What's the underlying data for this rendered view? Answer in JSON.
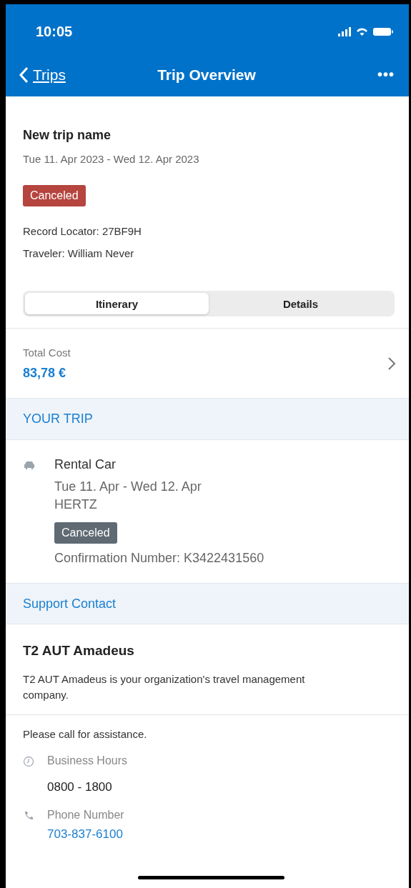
{
  "status_bar": {
    "time": "10:05"
  },
  "nav": {
    "back": "Trips",
    "title": "Trip Overview",
    "more": "•••"
  },
  "trip": {
    "name": "New trip name",
    "dates": "Tue 11. Apr 2023 - Wed 12. Apr 2023",
    "status": "Canceled",
    "record_locator": "Record Locator: 27BF9H",
    "traveler": "Traveler: William Never"
  },
  "tabs": [
    {
      "label": "Itinerary",
      "selected": true
    },
    {
      "label": "Details",
      "selected": false
    }
  ],
  "total": {
    "label": "Total Cost",
    "value": "83,78 €"
  },
  "your_trip": {
    "heading": "YOUR TRIP",
    "segments": [
      {
        "kind": "car",
        "title": "Rental Car",
        "dates": "Tue 11. Apr - Wed 12. Apr",
        "vendor": "HERTZ",
        "status": "Canceled",
        "confirmation": "Confirmation Number: K3422431560"
      }
    ]
  },
  "support": {
    "heading": "Support Contact",
    "company": "T2 AUT Amadeus",
    "description": "T2 AUT Amadeus is your organization's travel management company.",
    "prompt": "Please call for assistance.",
    "items": [
      {
        "kind": "hours",
        "label": "Business Hours",
        "value": "0800 - 1800"
      },
      {
        "kind": "phone",
        "label": "Phone Number",
        "value": "703-837-6100"
      }
    ]
  }
}
